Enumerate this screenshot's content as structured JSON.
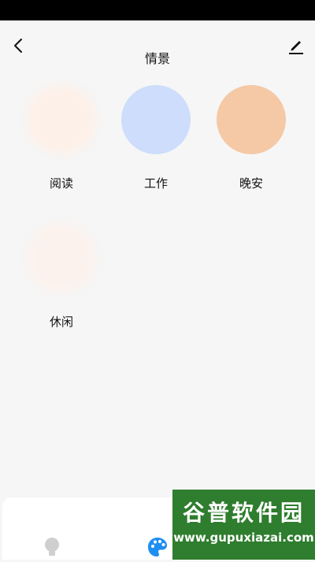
{
  "header": {
    "title": "情景",
    "back_icon": "chevron-left-icon",
    "edit_icon": "pencil-icon"
  },
  "scenes": [
    {
      "label": "阅读",
      "color": "#fdf0e8"
    },
    {
      "label": "工作",
      "color": "#cdddfb"
    },
    {
      "label": "晚安",
      "color": "#f5c9a6"
    },
    {
      "label": "休闲",
      "color": "#fcf2ed"
    }
  ],
  "bottom_nav": {
    "items": [
      {
        "icon": "lightbulb-icon",
        "active": false
      },
      {
        "icon": "palette-icon",
        "active": true
      }
    ],
    "active_color": "#1f8ef1",
    "inactive_color": "#cfcfcf"
  },
  "watermark": {
    "title": "谷普软件园",
    "url": "www.gupuxiazai.com"
  }
}
